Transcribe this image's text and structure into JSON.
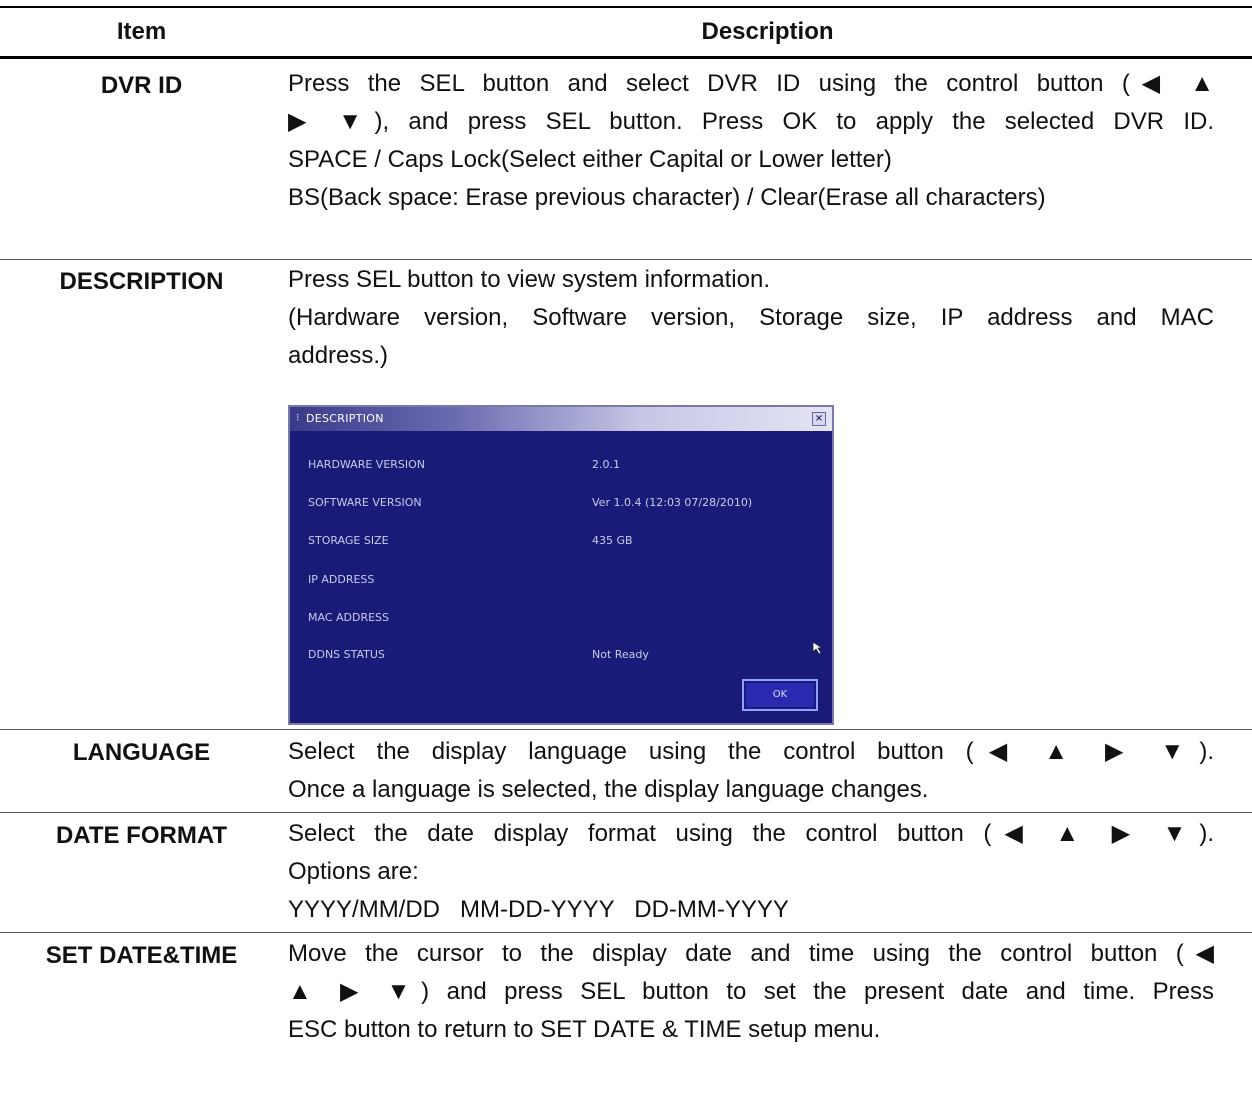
{
  "table": {
    "headers": {
      "item": "Item",
      "description": "Description"
    },
    "rows": [
      {
        "item": "DVR ID",
        "lines": [
          "Press the SEL button and select DVR ID using the control button (◀ ▲",
          "▶ ▼), and press SEL button. Press OK to apply the selected DVR ID.",
          "SPACE / Caps Lock(Select either Capital or Lower letter)",
          "BS(Back space: Erase previous character) / Clear(Erase all characters)"
        ]
      },
      {
        "item": "DESCRIPTION",
        "lines": [
          "Press SEL button to view system information.",
          "(Hardware version, Software version, Storage size, IP address and MAC",
          "address.)"
        ]
      },
      {
        "item": "LANGUAGE",
        "lines": [
          "Select the display language using the control button (◀ ▲ ▶ ▼).",
          "Once a language is selected, the display language changes."
        ]
      },
      {
        "item": "DATE FORMAT",
        "lines": [
          "Select the date display format using the control button (◀ ▲ ▶ ▼).",
          "Options are:",
          "YYYY/MM/DD   MM-DD-YYYY   DD-MM-YYYY"
        ]
      },
      {
        "item": "SET DATE&TIME",
        "lines": [
          "Move the cursor to the display date and time using the control button (◀",
          "▲ ▶ ▼) and press SEL button to set the present date and time. Press",
          "ESC button to return to SET DATE & TIME setup menu."
        ]
      }
    ]
  },
  "dialog": {
    "title": "DESCRIPTION",
    "close": "×",
    "fields": [
      {
        "label": "HARDWARE VERSION",
        "value": "2.0.1"
      },
      {
        "label": "SOFTWARE VERSION",
        "value": "Ver 1.0.4 (12:03 07/28/2010)"
      },
      {
        "label": "STORAGE SIZE",
        "value": "435 GB"
      },
      {
        "label": "IP ADDRESS",
        "value": ""
      },
      {
        "label": "MAC ADDRESS",
        "value": ""
      },
      {
        "label": "DDNS STATUS",
        "value": "Not Ready"
      }
    ],
    "ok_label": "OK"
  }
}
